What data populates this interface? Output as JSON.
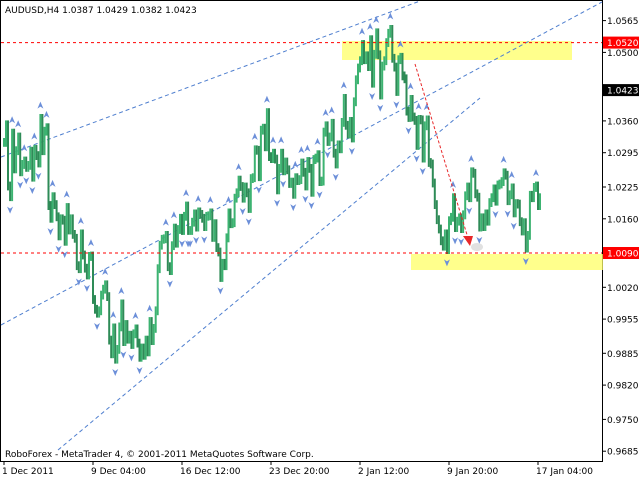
{
  "chart_data": {
    "type": "line",
    "title": "AUDUSD,H4  1.0387 1.0429 1.0382 1.0423",
    "footer": "RoboForex - MetaTrader 4, © 2001-2011 MetaQuotes Software Corp.",
    "ylim": [
      0.9665,
      1.0605
    ],
    "grid": false,
    "y_ticks": [
      "1.0565",
      "1.0500",
      "1.0360",
      "1.0295",
      "1.0225",
      "1.0160",
      "1.0020",
      "0.9955",
      "0.9885",
      "0.9820",
      "0.9750",
      "0.9685"
    ],
    "x_ticks": [
      "1 Dec 2011",
      "9 Dec 04:00",
      "16 Dec 12:00",
      "23 Dec 20:00",
      "2 Jan 12:00",
      "9 Jan 20:00",
      "17 Jan 04:00"
    ],
    "x_tick_index": [
      0,
      44,
      88,
      132,
      176,
      220,
      264
    ],
    "levels": [
      {
        "label": "1.0520",
        "value": 1.052,
        "color": "#ff0000"
      },
      {
        "label": "1.0090",
        "value": 1.009,
        "color": "#ff0000"
      }
    ],
    "current_price": {
      "label": "1.0423",
      "value": 1.0423
    },
    "series": [
      {
        "color": "#3cb371",
        "close": [
          1.0316,
          1.0352,
          1.0227,
          1.0205,
          1.0335,
          1.0262,
          1.0299,
          1.0327,
          1.0256,
          1.0271,
          1.0278,
          1.0265,
          1.0269,
          1.0298,
          1.0245,
          1.0302,
          1.0289,
          1.0274,
          1.0365,
          1.0299,
          1.0339,
          1.0346,
          1.0187,
          1.0161,
          1.0205,
          1.0189,
          1.0164,
          1.0125,
          1.016,
          1.0157,
          1.0114,
          1.0183,
          1.0137,
          1.016,
          1.0128,
          1.012,
          1.0064,
          1.0058,
          1.0129,
          1.0086,
          1.0059,
          1.0045,
          1.0083,
          1.0084,
          0.9995,
          0.9975,
          0.9967,
          0.9972,
          1.0004,
          1.0016,
          1.0025,
          1.0001,
          0.9912,
          0.9884,
          0.9937,
          0.9873,
          0.9893,
          0.9939,
          0.9986,
          0.9909,
          0.9944,
          0.9914,
          0.9922,
          0.9903,
          0.9925,
          0.9935,
          0.9906,
          0.9877,
          0.9896,
          0.9881,
          0.9912,
          0.9888,
          0.995,
          0.9911,
          0.9936,
          0.9972,
          1.0058,
          1.0106,
          1.0118,
          1.0119,
          1.0126,
          1.0062,
          1.0054,
          1.0105,
          1.0141,
          1.011,
          1.0138,
          1.0161,
          1.0136,
          1.0165,
          1.0186,
          1.0136,
          1.0136,
          1.0153,
          1.017,
          1.0143,
          1.0174,
          1.0169,
          1.0161,
          1.0144,
          1.0165,
          1.0166,
          1.0172,
          1.0122,
          1.015,
          1.0101,
          1.0092,
          1.004,
          1.0069,
          1.0064,
          1.0121,
          1.0172,
          1.015,
          1.0152,
          1.0202,
          1.0213,
          1.0239,
          1.0226,
          1.0202,
          1.0225,
          1.0213,
          1.0181,
          1.0242,
          1.0244,
          1.0301,
          1.03,
          1.0246,
          1.0341,
          1.0345,
          1.0307,
          1.0377,
          1.0287,
          1.0283,
          1.0294,
          1.0282,
          1.0219,
          1.0263,
          1.0294,
          1.0258,
          1.0276,
          1.026,
          1.0232,
          1.0235,
          1.021,
          1.0244,
          1.0238,
          1.024,
          1.0274,
          1.0255,
          1.0227,
          1.0277,
          1.0263,
          1.0214,
          1.0281,
          1.0284,
          1.0291,
          1.0236,
          1.0237,
          1.0337,
          1.035,
          1.0318,
          1.0327,
          1.0355,
          1.0294,
          1.0272,
          1.0311,
          1.0303,
          1.0357,
          1.0406,
          1.0351,
          1.0333,
          1.0359,
          1.0325,
          1.0399,
          1.0444,
          1.0468,
          1.0483,
          1.0516,
          1.0485,
          1.0493,
          1.0471,
          1.0526,
          1.0437,
          1.0496,
          1.054,
          1.0495,
          1.0413,
          1.0472,
          1.0483,
          1.052,
          1.0539,
          1.0547,
          1.0488,
          1.047,
          1.042,
          1.0485,
          1.049,
          1.0452,
          1.0446,
          1.038,
          1.0367,
          1.0404,
          1.0368,
          1.0361,
          1.031,
          1.0363,
          1.0362,
          1.0284,
          1.035,
          1.0362,
          1.0275,
          1.0272,
          1.0233,
          1.0189,
          1.0158,
          1.0139,
          1.0115,
          1.0104,
          1.0129,
          1.0097,
          1.0156,
          1.0163,
          1.0203,
          1.0142,
          1.0155,
          1.0162,
          1.014,
          1.0168,
          1.0207,
          1.0225,
          1.0203,
          1.0256,
          1.0253,
          1.0211,
          1.0204,
          1.0143,
          1.0162,
          1.0144,
          1.017,
          1.0155,
          1.0193,
          1.0203,
          1.0221,
          1.0196,
          1.0229,
          1.0231,
          1.0236,
          1.0254,
          1.0249,
          1.0197,
          1.0209,
          1.0223,
          1.0172,
          1.0191,
          1.019,
          1.0154,
          1.0135,
          1.0152,
          1.01,
          1.0126,
          1.0208,
          1.0203,
          1.0224,
          1.0227,
          1.0187,
          1.0203
        ]
      }
    ]
  }
}
